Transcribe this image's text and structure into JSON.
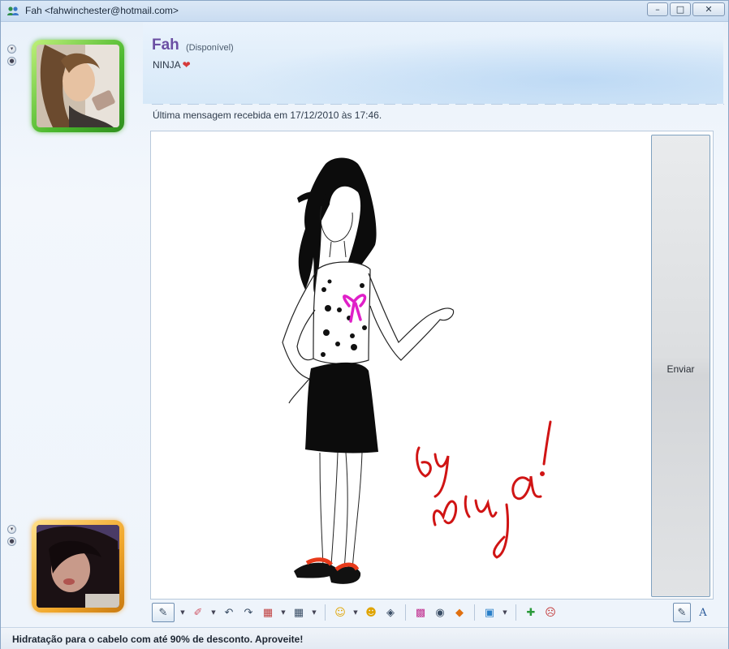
{
  "window": {
    "title": "Fah <fahwinchester@hotmail.com>",
    "minimize_icon": "minimize-icon",
    "maximize_icon": "maximize-icon",
    "close_icon": "close-icon"
  },
  "contact": {
    "name": "Fah",
    "status": "(Disponível)",
    "personal_message": "NINJA",
    "status_color": "#4bb82e"
  },
  "conversation": {
    "last_message": "Última mensagem recebida em 17/12/2010 às 17:46.",
    "ink_signature": "by Ninja!",
    "send_label": "Enviar"
  },
  "self": {
    "status_color": "#f1a82c"
  },
  "toolbar": {
    "items": [
      "pen",
      "eraser",
      "undo",
      "redo",
      "background-color",
      "grid",
      "emoticons",
      "nudge",
      "wink",
      "backgrounds",
      "voice-clip",
      "games",
      "share-files",
      "invite",
      "blocked",
      "handwriting",
      "font"
    ]
  },
  "ad": {
    "text": "Hidratação para o cabelo com até 90% de desconto. Aproveite!"
  }
}
